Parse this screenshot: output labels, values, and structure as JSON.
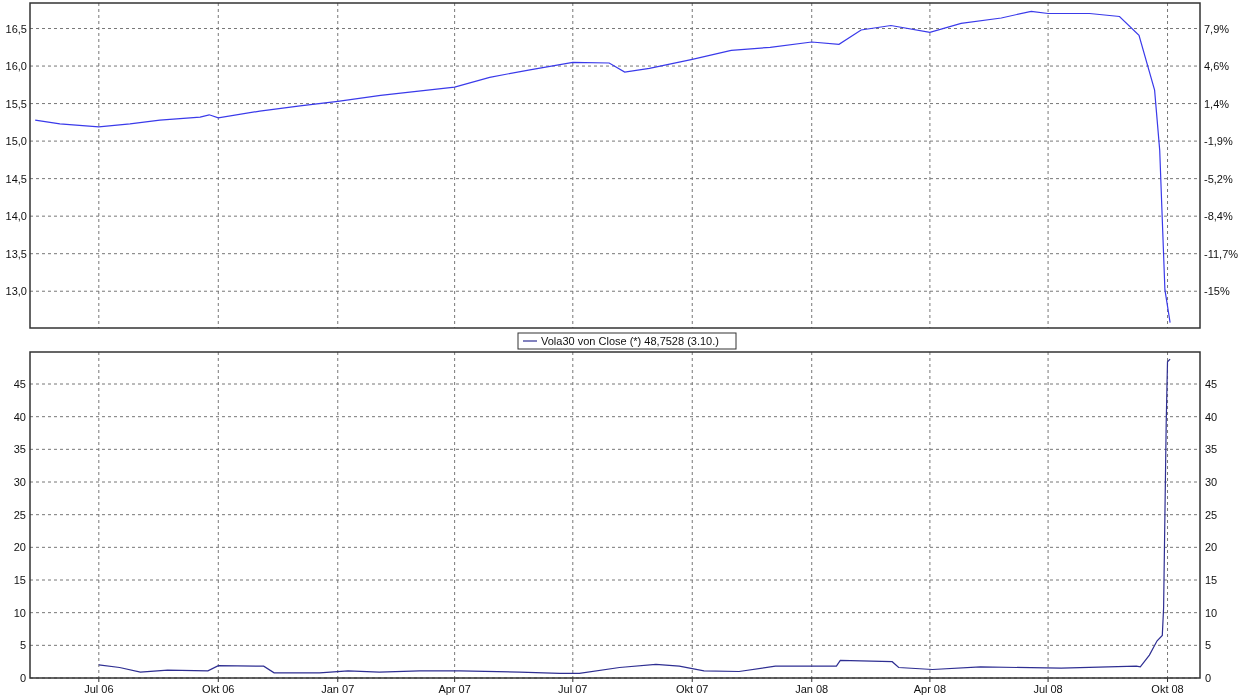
{
  "price_panel": {
    "chart_data": {
      "type": "line",
      "grid": true,
      "xlim": [
        "2006-05-09",
        "2008-10-26"
      ],
      "ylim": [
        12.51,
        16.84
      ],
      "yticks": [
        {
          "value": 13,
          "label": "13,0"
        },
        {
          "value": 13.5,
          "label": "13,5"
        },
        {
          "value": 14,
          "label": "14,0"
        },
        {
          "value": 14.5,
          "label": "14,5"
        },
        {
          "value": 15,
          "label": "15,0"
        },
        {
          "value": 15.5,
          "label": "15,5"
        },
        {
          "value": 16,
          "label": "16,0"
        },
        {
          "value": 16.5,
          "label": "16,5"
        }
      ],
      "x": [
        "2006-05-13",
        "2006-06-01",
        "2006-07-01",
        "2006-07-25",
        "2006-08-17",
        "2006-09-17",
        "2006-09-24",
        "2006-10-01",
        "2006-11-02",
        "2006-12-03",
        "2007-01-01",
        "2007-02-03",
        "2007-03-06",
        "2007-04-01",
        "2007-04-28",
        "2007-05-29",
        "2007-07-01",
        "2007-07-29",
        "2007-08-10",
        "2007-08-29",
        "2007-10-01",
        "2007-10-31",
        "2007-11-30",
        "2008-01-01",
        "2008-01-22",
        "2008-02-08",
        "2008-03-02",
        "2008-04-01",
        "2008-04-25",
        "2008-05-26",
        "2008-06-18",
        "2008-07-01",
        "2008-08-02",
        "2008-08-25",
        "2008-09-09",
        "2008-09-21",
        "2008-09-25",
        "2008-09-29",
        "2008-10-03"
      ],
      "series": [
        {
          "color": "#3a3aea",
          "values": [
            15.28,
            15.23,
            15.19,
            15.23,
            15.28,
            15.32,
            15.35,
            15.31,
            15.4,
            15.47,
            15.53,
            15.61,
            15.67,
            15.72,
            15.85,
            15.95,
            16.05,
            16.04,
            15.92,
            15.97,
            16.09,
            16.21,
            16.25,
            16.32,
            16.29,
            16.48,
            16.54,
            16.45,
            16.57,
            16.64,
            16.73,
            16.7,
            16.7,
            16.66,
            16.41,
            15.68,
            14.88,
            13.02,
            12.58
          ]
        }
      ]
    },
    "right_axis_labels": [
      "7,9%",
      "4,6%",
      "1,4%",
      "-1,9%",
      "-5,2%",
      "-8,4%",
      "-11,7%",
      "-15%"
    ]
  },
  "volatility_panel": {
    "chart_data": {
      "type": "line",
      "grid": true,
      "xlim": [
        "2006-05-09",
        "2008-10-26"
      ],
      "ylim": [
        0,
        49.9
      ],
      "xticks": [
        {
          "value": "2006-07-01",
          "label": "Jul 06"
        },
        {
          "value": "2006-10-01",
          "label": "Okt 06"
        },
        {
          "value": "2007-01-01",
          "label": "Jan 07"
        },
        {
          "value": "2007-04-01",
          "label": "Apr 07"
        },
        {
          "value": "2007-07-01",
          "label": "Jul 07"
        },
        {
          "value": "2007-10-01",
          "label": "Okt 07"
        },
        {
          "value": "2008-01-01",
          "label": "Jan 08"
        },
        {
          "value": "2008-04-01",
          "label": "Apr 08"
        },
        {
          "value": "2008-07-01",
          "label": "Jul 08"
        },
        {
          "value": "2008-10-01",
          "label": "Okt 08"
        }
      ],
      "yticks": [
        {
          "value": 0,
          "label": "0"
        },
        {
          "value": 5,
          "label": "5"
        },
        {
          "value": 10,
          "label": "10"
        },
        {
          "value": 15,
          "label": "15"
        },
        {
          "value": 20,
          "label": "20"
        },
        {
          "value": 25,
          "label": "25"
        },
        {
          "value": 30,
          "label": "30"
        },
        {
          "value": 35,
          "label": "35"
        },
        {
          "value": 40,
          "label": "40"
        },
        {
          "value": 45,
          "label": "45"
        }
      ],
      "x": [
        "2006-07-01",
        "2006-07-17",
        "2006-08-02",
        "2006-08-23",
        "2006-09-23",
        "2006-10-01",
        "2006-11-05",
        "2006-11-13",
        "2006-12-18",
        "2007-01-09",
        "2007-02-02",
        "2007-03-05",
        "2007-04-05",
        "2007-05-21",
        "2007-06-21",
        "2007-07-06",
        "2007-08-06",
        "2007-09-03",
        "2007-09-21",
        "2007-10-10",
        "2007-11-06",
        "2007-12-04",
        "2008-01-20",
        "2008-01-23",
        "2008-03-03",
        "2008-03-08",
        "2008-04-03",
        "2008-05-10",
        "2008-07-11",
        "2008-09-07",
        "2008-09-10",
        "2008-09-17",
        "2008-09-23",
        "2008-09-27",
        "2008-09-28",
        "2008-09-30",
        "2008-10-01",
        "2008-10-03"
      ],
      "series": [
        {
          "name": "Vola30 von Close (*) 48,7528 (3.10.)",
          "color": "#2e2e92",
          "values": [
            2,
            1.6,
            0.9,
            1.2,
            1.1,
            1.9,
            1.8,
            0.8,
            0.8,
            1.1,
            0.9,
            1.1,
            1.1,
            0.9,
            0.7,
            0.7,
            1.6,
            2.1,
            1.8,
            1.1,
            1,
            1.8,
            1.8,
            2.7,
            2.5,
            1.6,
            1.3,
            1.7,
            1.5,
            1.8,
            1.7,
            3.5,
            5.7,
            6.5,
            10.7,
            39,
            48.4,
            48.8
          ]
        }
      ]
    },
    "right_axis_labels": [
      "45",
      "40",
      "35",
      "30",
      "25",
      "20",
      "15",
      "10",
      "5",
      "0"
    ]
  }
}
